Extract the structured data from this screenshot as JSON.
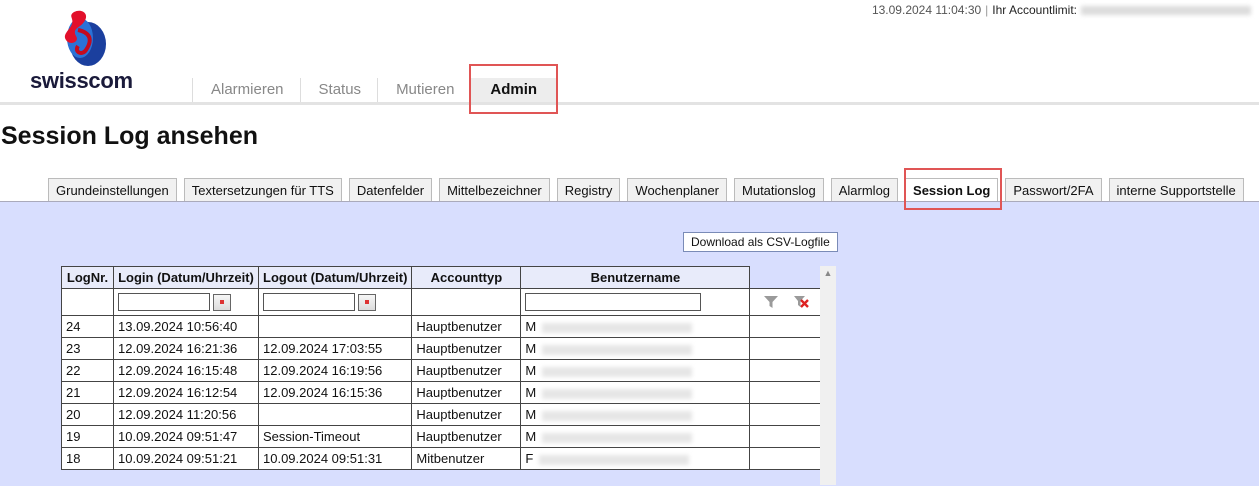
{
  "header": {
    "timestamp": "13.09.2024 11:04:30",
    "separator": "|",
    "account_limit_label": "Ihr Accountlimit:"
  },
  "logo": {
    "text": "swisscom"
  },
  "main_tabs": [
    {
      "label": "Alarmieren"
    },
    {
      "label": "Status"
    },
    {
      "label": "Mutieren"
    },
    {
      "label": "Admin",
      "active": true
    }
  ],
  "page_title": "Session Log ansehen",
  "sub_tabs": [
    {
      "label": "Grundeinstellungen"
    },
    {
      "label": "Textersetzungen für TTS"
    },
    {
      "label": "Datenfelder"
    },
    {
      "label": "Mittelbezeichner"
    },
    {
      "label": "Registry"
    },
    {
      "label": "Wochenplaner"
    },
    {
      "label": "Mutationslog"
    },
    {
      "label": "Alarmlog"
    },
    {
      "label": "Session Log",
      "active": true
    },
    {
      "label": "Passwort/2FA"
    },
    {
      "label": "interne Supportstelle"
    }
  ],
  "csv_button": "Download als CSV-Logfile",
  "table": {
    "headers": [
      "LogNr.",
      "Login (Datum/Uhrzeit)",
      "Logout (Datum/Uhrzeit)",
      "Accounttyp",
      "Benutzername"
    ],
    "rows": [
      {
        "nr": "24",
        "login": "13.09.2024 10:56:40",
        "logout": "",
        "type": "Hauptbenutzer",
        "user": "M"
      },
      {
        "nr": "23",
        "login": "12.09.2024 16:21:36",
        "logout": "12.09.2024 17:03:55",
        "type": "Hauptbenutzer",
        "user": "M"
      },
      {
        "nr": "22",
        "login": "12.09.2024 16:15:48",
        "logout": "12.09.2024 16:19:56",
        "type": "Hauptbenutzer",
        "user": "M"
      },
      {
        "nr": "21",
        "login": "12.09.2024 16:12:54",
        "logout": "12.09.2024 16:15:36",
        "type": "Hauptbenutzer",
        "user": "M"
      },
      {
        "nr": "20",
        "login": "12.09.2024 11:20:56",
        "logout": "",
        "type": "Hauptbenutzer",
        "user": "M"
      },
      {
        "nr": "19",
        "login": "10.09.2024 09:51:47",
        "logout": "Session-Timeout",
        "type": "Hauptbenutzer",
        "user": "M"
      },
      {
        "nr": "18",
        "login": "10.09.2024 09:51:21",
        "logout": "10.09.2024 09:51:31",
        "type": "Mitbenutzer",
        "user": "F"
      }
    ]
  },
  "colors": {
    "highlight": "#e05555",
    "panel_bg": "#d8defe"
  }
}
